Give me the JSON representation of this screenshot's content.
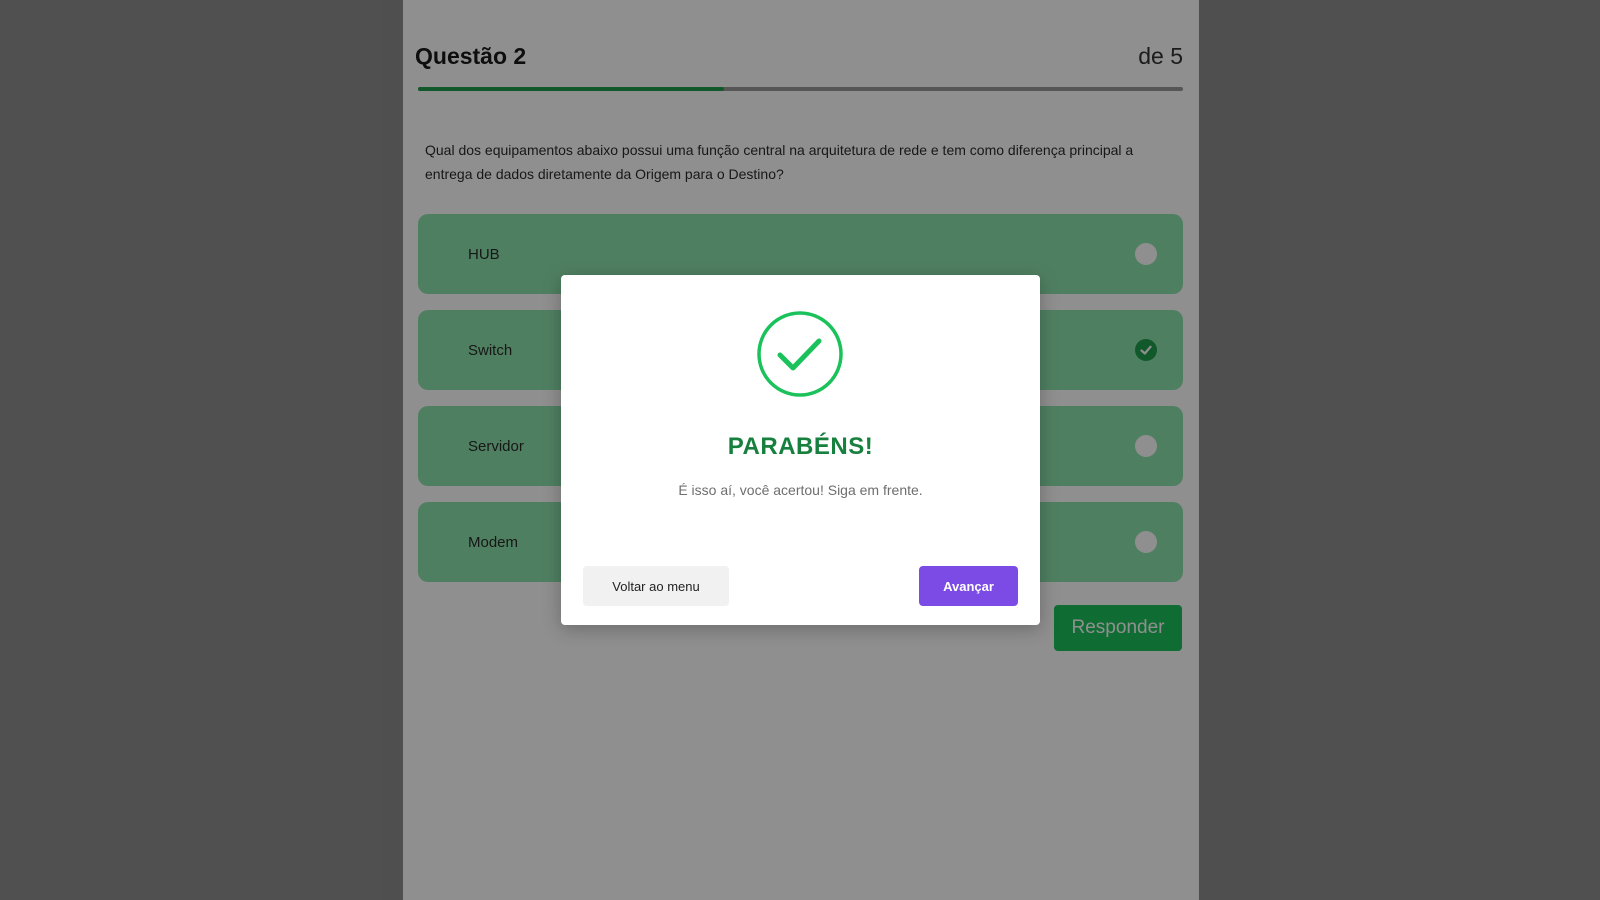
{
  "quiz": {
    "question_label": "Questão 2",
    "total_label": "de 5",
    "progress_fraction": 0.4,
    "question_text": "Qual dos equipamentos abaixo possui uma função central na arquitetura de rede e tem como diferença principal a entrega de dados diretamente da Origem para o Destino?",
    "options": [
      {
        "label": "HUB",
        "selected": false
      },
      {
        "label": "Switch",
        "selected": true
      },
      {
        "label": "Servidor",
        "selected": false
      },
      {
        "label": "Modem",
        "selected": false
      }
    ],
    "submit_label": "Responder"
  },
  "modal": {
    "icon": "check-circle-icon",
    "title": "PARABÉNS!",
    "message": "É isso aí, você acertou! Siga em frente.",
    "menu_button_label": "Voltar ao menu",
    "next_button_label": "Avançar"
  },
  "colors": {
    "accent_green": "#1f9e4d",
    "option_green": "#8ee3ad",
    "title_green": "#17803f",
    "primary_purple": "#7c4be6"
  }
}
